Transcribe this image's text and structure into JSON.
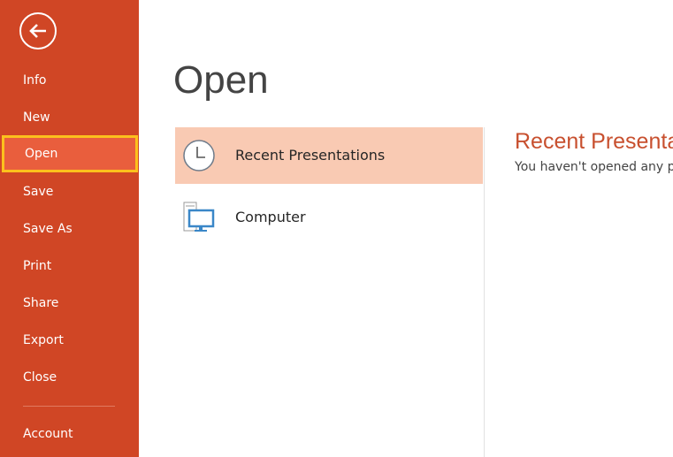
{
  "sidebar": {
    "back_icon": "back-arrow-icon",
    "items": [
      {
        "label": "Info"
      },
      {
        "label": "New"
      },
      {
        "label": "Open",
        "active": true
      },
      {
        "label": "Save"
      },
      {
        "label": "Save As"
      },
      {
        "label": "Print"
      },
      {
        "label": "Share"
      },
      {
        "label": "Export"
      },
      {
        "label": "Close"
      },
      {
        "label": "Account"
      }
    ]
  },
  "main": {
    "title": "Open",
    "places": [
      {
        "label": "Recent Presentations",
        "icon": "clock-icon",
        "selected": true
      },
      {
        "label": "Computer",
        "icon": "computer-icon"
      }
    ],
    "detail": {
      "heading": "Recent Presentations",
      "message": "You haven't opened any pre"
    }
  },
  "colors": {
    "sidebar": "#d04625",
    "active_item": "#e95e3d",
    "highlight_border": "#fcc11d",
    "selected_place": "#f9cab3",
    "heading": "#c8502f"
  }
}
